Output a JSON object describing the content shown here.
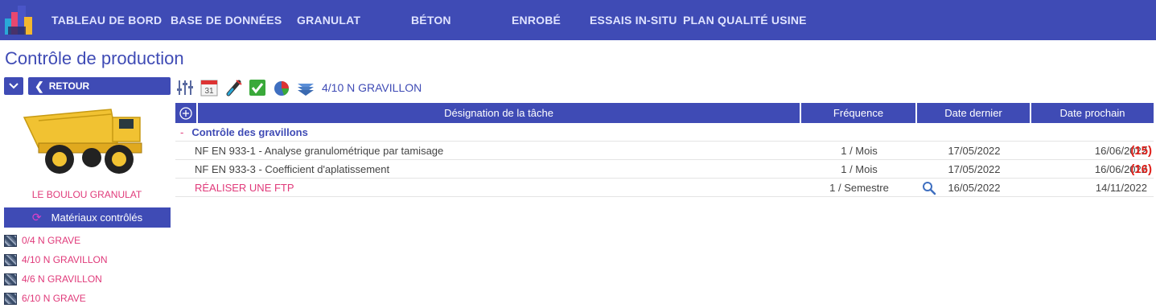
{
  "nav": {
    "items": [
      {
        "label": "TABLEAU DE BORD"
      },
      {
        "label": "BASE DE DONNÉES"
      },
      {
        "label": "GRANULAT"
      },
      {
        "label": "BÉTON"
      },
      {
        "label": "ENROBÉ"
      },
      {
        "label": "ESSAIS IN-SITU"
      },
      {
        "label": "PLAN QUALITÉ USINE"
      }
    ]
  },
  "page": {
    "title": "Contrôle de production"
  },
  "sidebar": {
    "back_label": "RETOUR",
    "supplier": "LE BOULOU GRANULAT",
    "materials_header": "Matériaux contrôlés",
    "materials": [
      {
        "label": "0/4 N GRAVE"
      },
      {
        "label": "4/10 N GRAVILLON"
      },
      {
        "label": "4/6 N GRAVILLON"
      },
      {
        "label": "6/10 N GRAVE"
      }
    ]
  },
  "toolbar": {
    "icons": [
      "sliders-icon",
      "calendar-icon",
      "test-tube-icon",
      "check-icon",
      "pie-chart-icon",
      "layers-icon"
    ],
    "calendar_day": "31",
    "current_material": "4/10 N GRAVILLON"
  },
  "grid": {
    "headers": {
      "designation": "Désignation de la tâche",
      "frequency": "Fréquence",
      "last_date": "Date dernier",
      "next_date": "Date prochain"
    },
    "group": {
      "toggle": "-",
      "label": "Contrôle des gravillons"
    },
    "rows": [
      {
        "designation": "NF EN 933-1 - Analyse granulométrique par tamisage",
        "frequency": "1 / Mois",
        "last": "17/05/2022",
        "next": "16/06/2022",
        "count": "(15)"
      },
      {
        "designation": "NF EN 933-3 - Coefficient d'aplatissement",
        "frequency": "1 / Mois",
        "last": "17/05/2022",
        "next": "16/06/2022",
        "count": "(16)"
      },
      {
        "designation": "RÉALISER UNE FTP",
        "frequency": "1 / Semestre",
        "last": "16/05/2022",
        "next": "14/11/2022",
        "count": ""
      }
    ]
  },
  "colors": {
    "primary": "#3f4bb5",
    "accent_pink": "#e03a7a",
    "alert_red": "#e0201a"
  }
}
